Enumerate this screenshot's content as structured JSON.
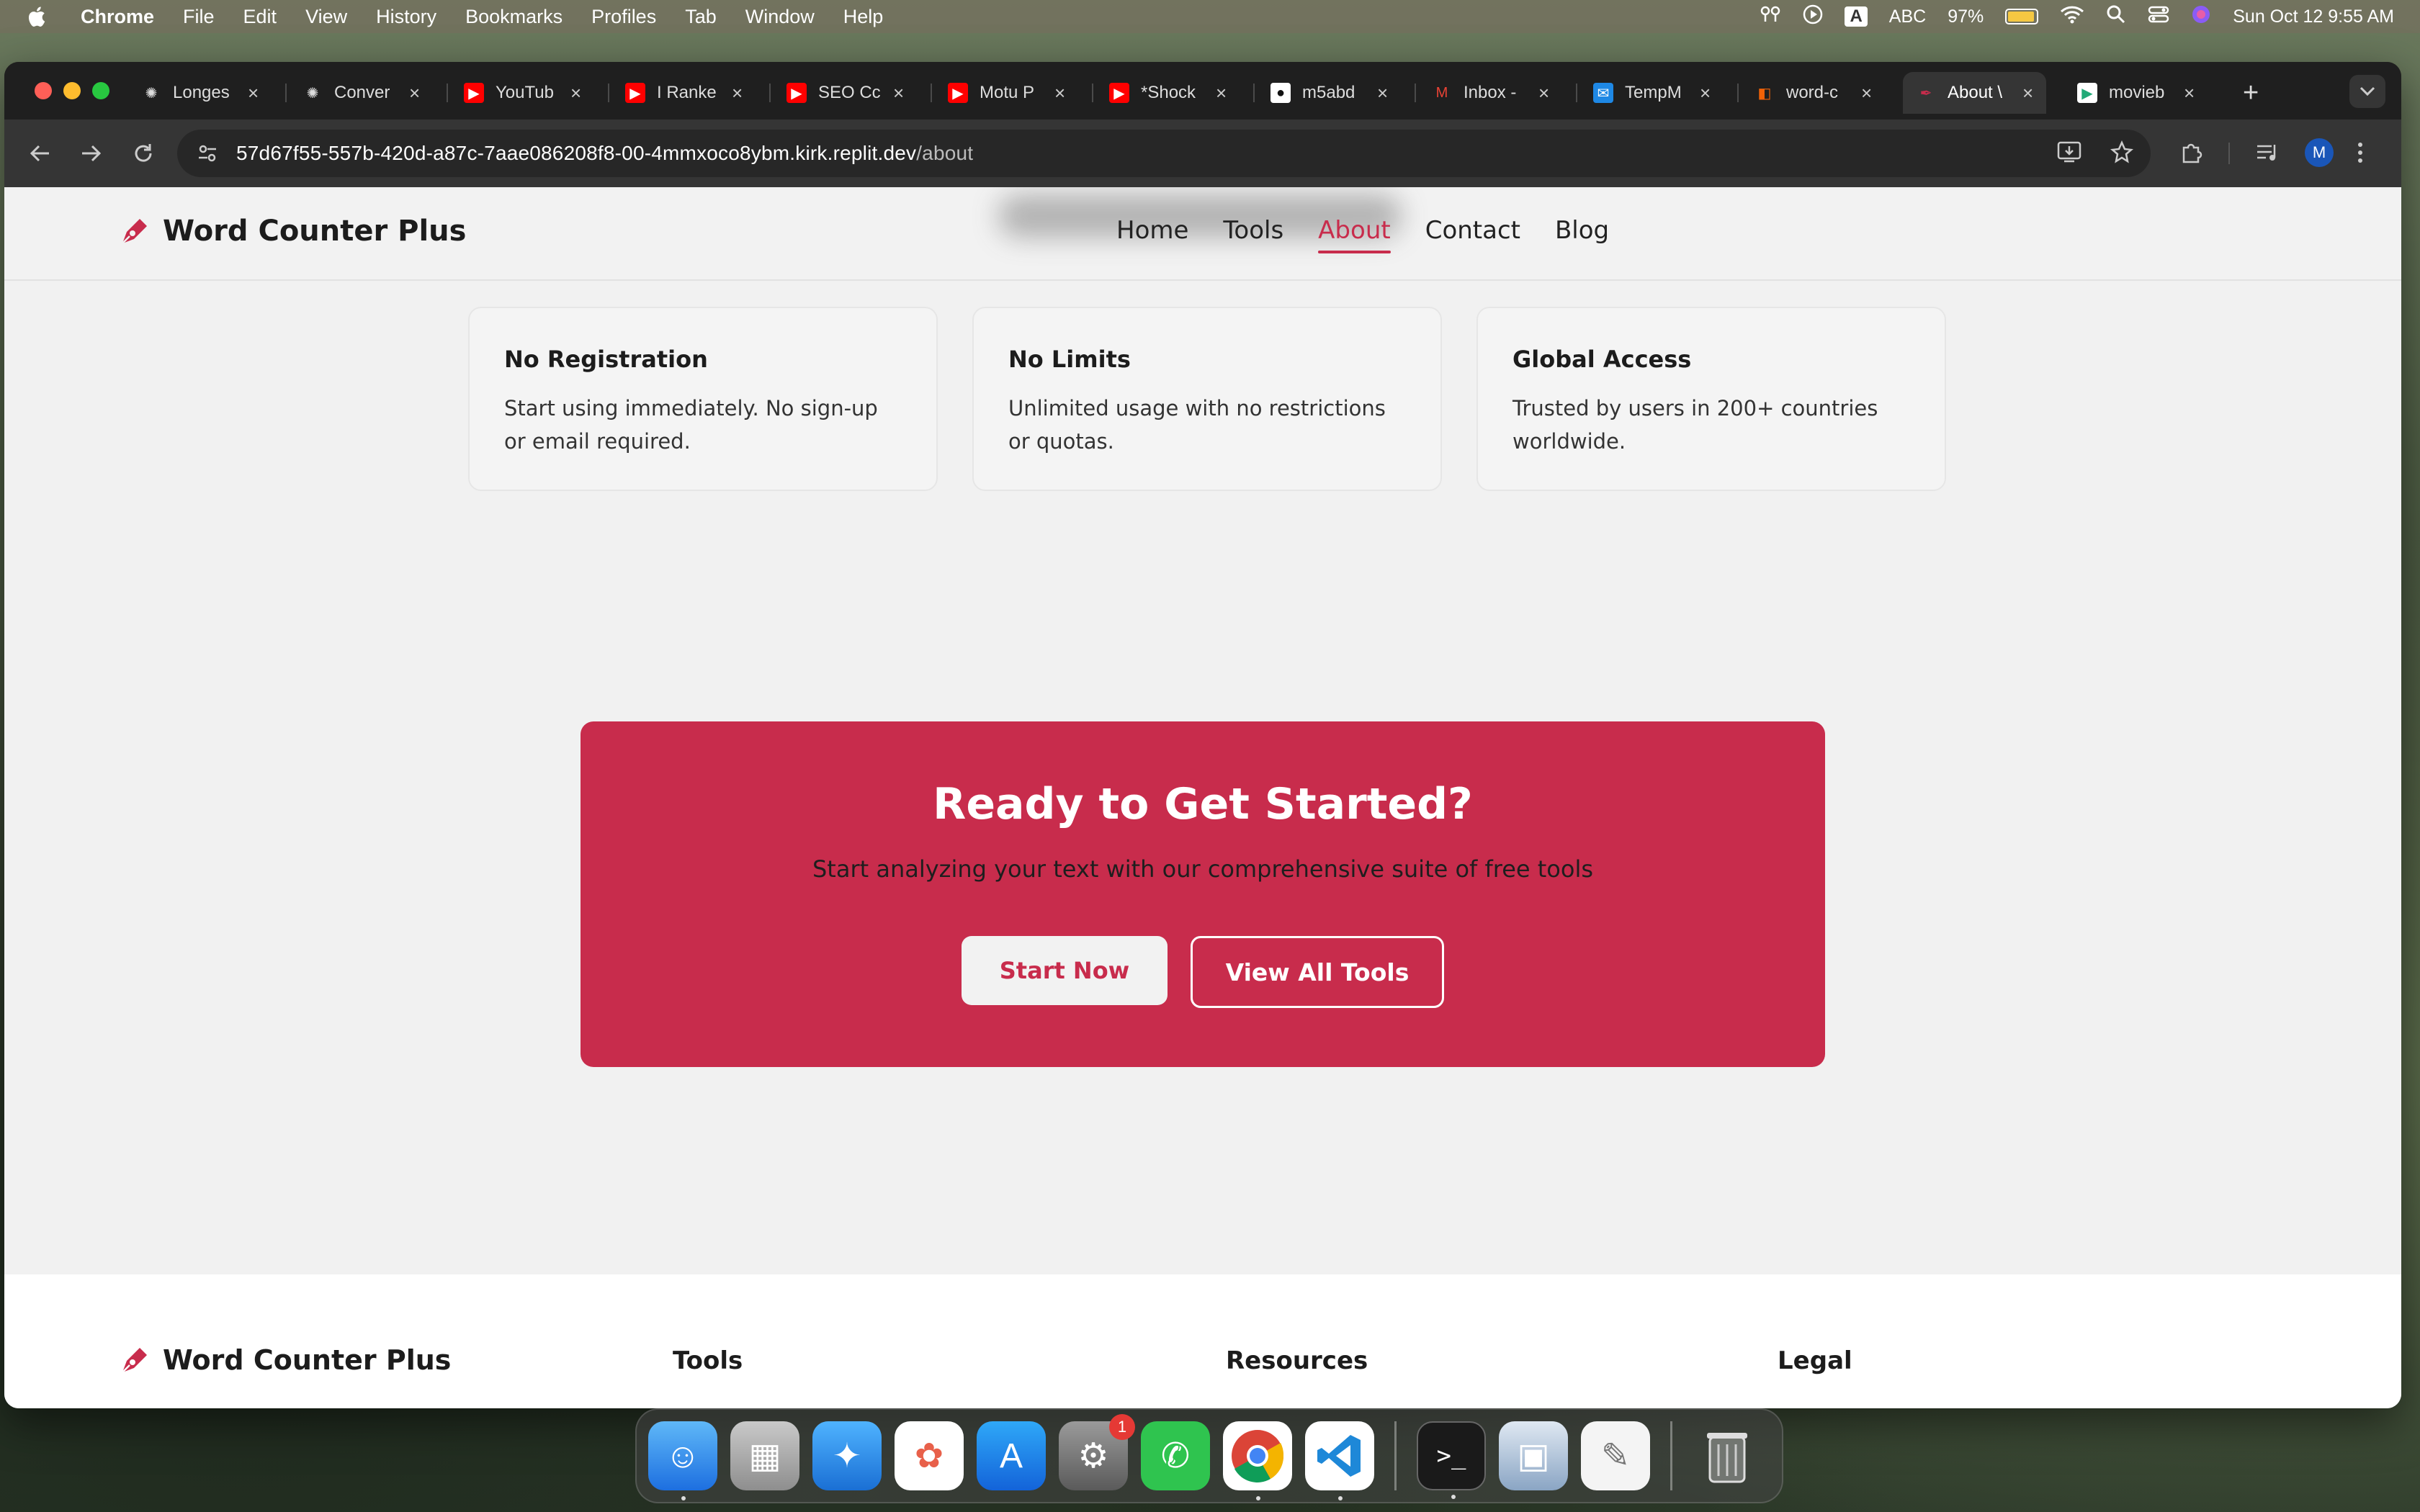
{
  "menubar": {
    "app": "Chrome",
    "items": [
      "File",
      "Edit",
      "View",
      "History",
      "Bookmarks",
      "Profiles",
      "Tab",
      "Window",
      "Help"
    ],
    "input_source": "A",
    "input_label": "ABC",
    "battery": "97%",
    "clock": "Sun Oct 12  9:55 AM"
  },
  "tabs": [
    {
      "title": "Longes",
      "icon": "openai-icon"
    },
    {
      "title": "Conver",
      "icon": "openai-icon"
    },
    {
      "title": "YouTub",
      "icon": "youtube-icon"
    },
    {
      "title": "I Ranke",
      "icon": "youtube-icon"
    },
    {
      "title": "SEO Cc",
      "icon": "youtube-icon"
    },
    {
      "title": "Motu P",
      "icon": "youtube-icon"
    },
    {
      "title": "*Shock",
      "icon": "youtube-icon"
    },
    {
      "title": "m5abd",
      "icon": "github-icon"
    },
    {
      "title": "Inbox -",
      "icon": "gmail-icon"
    },
    {
      "title": "TempM",
      "icon": "tempmail-icon"
    },
    {
      "title": "word-c",
      "icon": "replit-icon"
    },
    {
      "title": "About \\",
      "icon": "pen-icon",
      "active": true
    },
    {
      "title": "movieb",
      "icon": "app-icon"
    }
  ],
  "address_bar": {
    "host": "57d67f55-557b-420d-a87c-7aae086208f8-00-4mmxoco8ybm.kirk.replit.dev",
    "path": "/about"
  },
  "profile_initial": "M",
  "site": {
    "brand": "Word Counter Plus",
    "nav": [
      "Home",
      "Tools",
      "About",
      "Contact",
      "Blog"
    ],
    "active_nav": "About",
    "accent": "#c82c4c",
    "cards": [
      {
        "title": "No Registration",
        "text": "Start using immediately. No sign-up or email required."
      },
      {
        "title": "No Limits",
        "text": "Unlimited usage with no restrictions or quotas."
      },
      {
        "title": "Global Access",
        "text": "Trusted by users in 200+ countries worldwide."
      }
    ],
    "cta": {
      "heading": "Ready to Get Started?",
      "subtext": "Start analyzing your text with our comprehensive suite of free tools",
      "primary": "Start Now",
      "secondary": "View All Tools"
    },
    "footer": {
      "brand": "Word Counter Plus",
      "columns": [
        "Tools",
        "Resources",
        "Legal"
      ]
    }
  },
  "dock": {
    "apps": [
      "finder",
      "launchpad",
      "safari",
      "photos",
      "app-store",
      "system-settings",
      "whatsapp",
      "chrome",
      "vscode",
      "terminal",
      "preview",
      "textedit",
      "trash"
    ],
    "settings_badge": "1"
  }
}
